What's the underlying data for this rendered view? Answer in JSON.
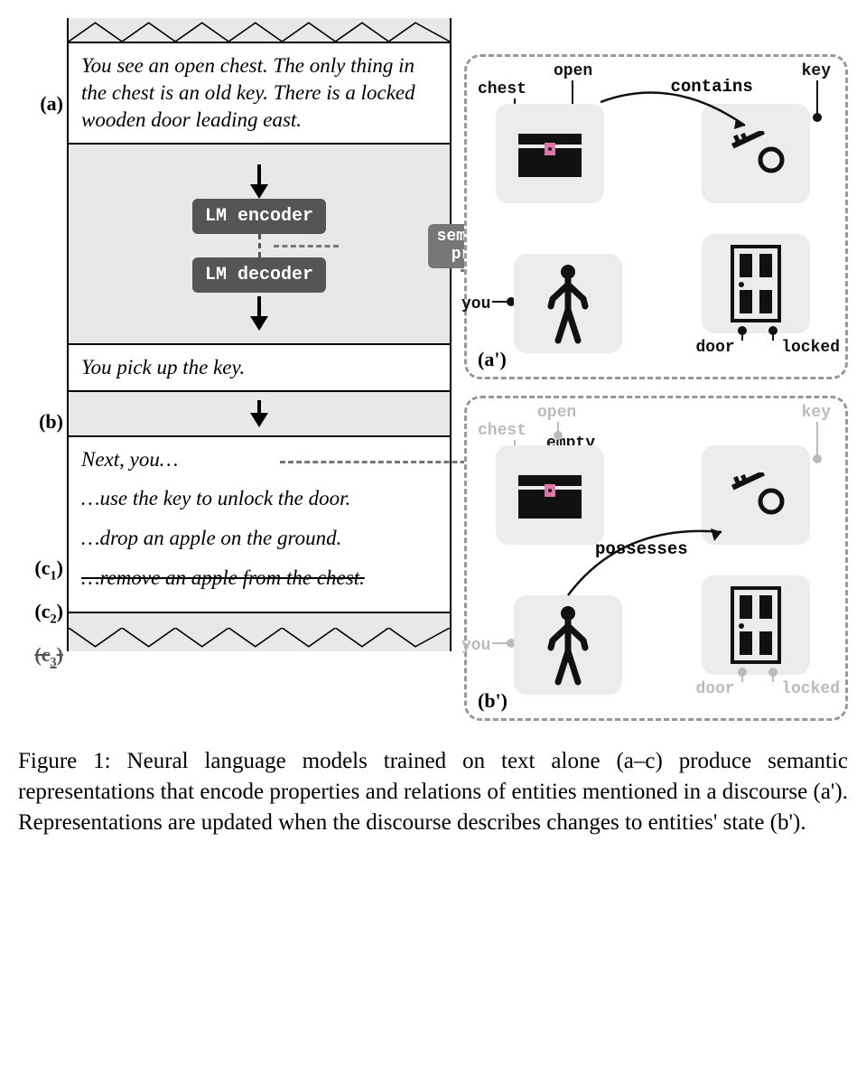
{
  "markers": {
    "a": "(a)",
    "b": "(b)",
    "c1_pre": "(c",
    "c1_sub": "1",
    "c2_pre": "(c",
    "c2_sub": "2",
    "c3_pre": "(c",
    "c3_sub": "3",
    "close": ")"
  },
  "text": {
    "a": "You see an open chest. The only thing in the chest is an old key. There is a locked wooden door leading east.",
    "b": "You pick up the key.",
    "next": "Next, you…",
    "c1": "…use the key to unlock the door.",
    "c2": "…drop an apple on the ground.",
    "c3": "…remove an apple from the chest."
  },
  "lm": {
    "encoder": "LM encoder",
    "decoder": "LM decoder",
    "probe_l1": "semantic",
    "probe_l2": "probe"
  },
  "state_a": {
    "label": "(a')",
    "entities": {
      "chest": "chest",
      "open": "open",
      "key": "key",
      "you": "you",
      "door": "door",
      "locked": "locked"
    },
    "relation": "contains"
  },
  "state_b": {
    "label": "(b')",
    "entities": {
      "chest": "chest",
      "open": "open",
      "empty": "empty",
      "key": "key",
      "you": "you",
      "door": "door",
      "locked": "locked"
    },
    "relation": "possesses"
  },
  "caption": "Figure 1:  Neural language models trained on text alone (a–c) produce semantic representations that encode properties and relations of entities mentioned in a discourse (a'). Representations are updated when the discourse describes changes to entities' state (b')."
}
